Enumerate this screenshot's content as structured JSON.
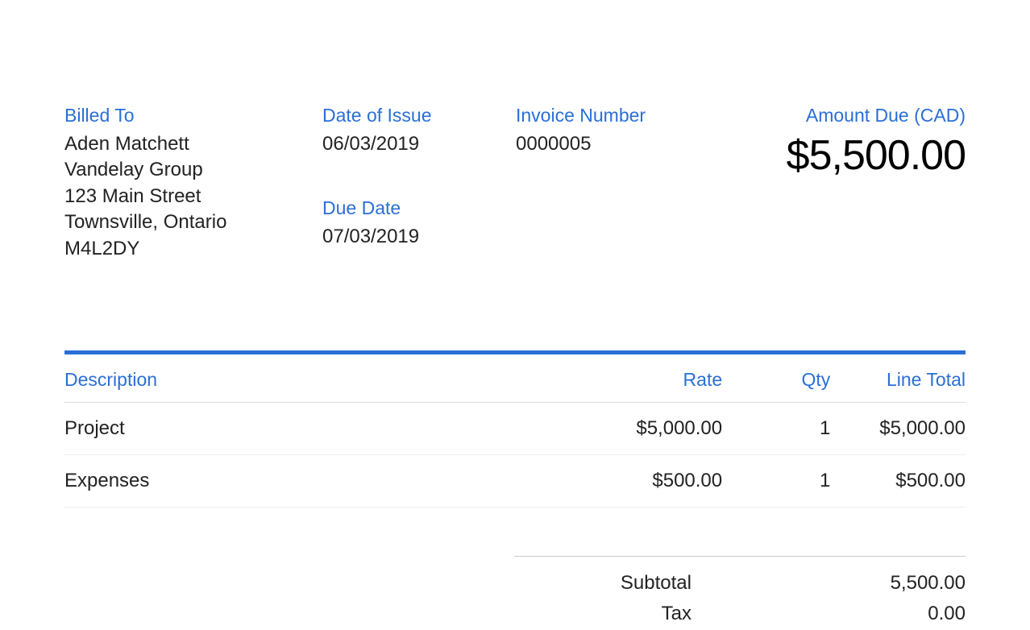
{
  "header": {
    "billed_to_label": "Billed To",
    "billed_to_lines": [
      "Aden Matchett",
      "Vandelay Group",
      "123 Main Street",
      "Townsville, Ontario",
      "M4L2DY"
    ],
    "date_of_issue_label": "Date of Issue",
    "date_of_issue": "06/03/2019",
    "due_date_label": "Due Date",
    "due_date": "07/03/2019",
    "invoice_number_label": "Invoice Number",
    "invoice_number": "0000005",
    "amount_due_label": "Amount Due (CAD)",
    "amount_due": "$5,500.00"
  },
  "columns": {
    "description": "Description",
    "rate": "Rate",
    "qty": "Qty",
    "line_total": "Line Total"
  },
  "items": [
    {
      "description": "Project",
      "rate": "$5,000.00",
      "qty": "1",
      "line_total": "$5,000.00"
    },
    {
      "description": "Expenses",
      "rate": "$500.00",
      "qty": "1",
      "line_total": "$500.00"
    }
  ],
  "totals": {
    "subtotal_label": "Subtotal",
    "subtotal": "5,500.00",
    "tax_label": "Tax",
    "tax": "0.00"
  }
}
